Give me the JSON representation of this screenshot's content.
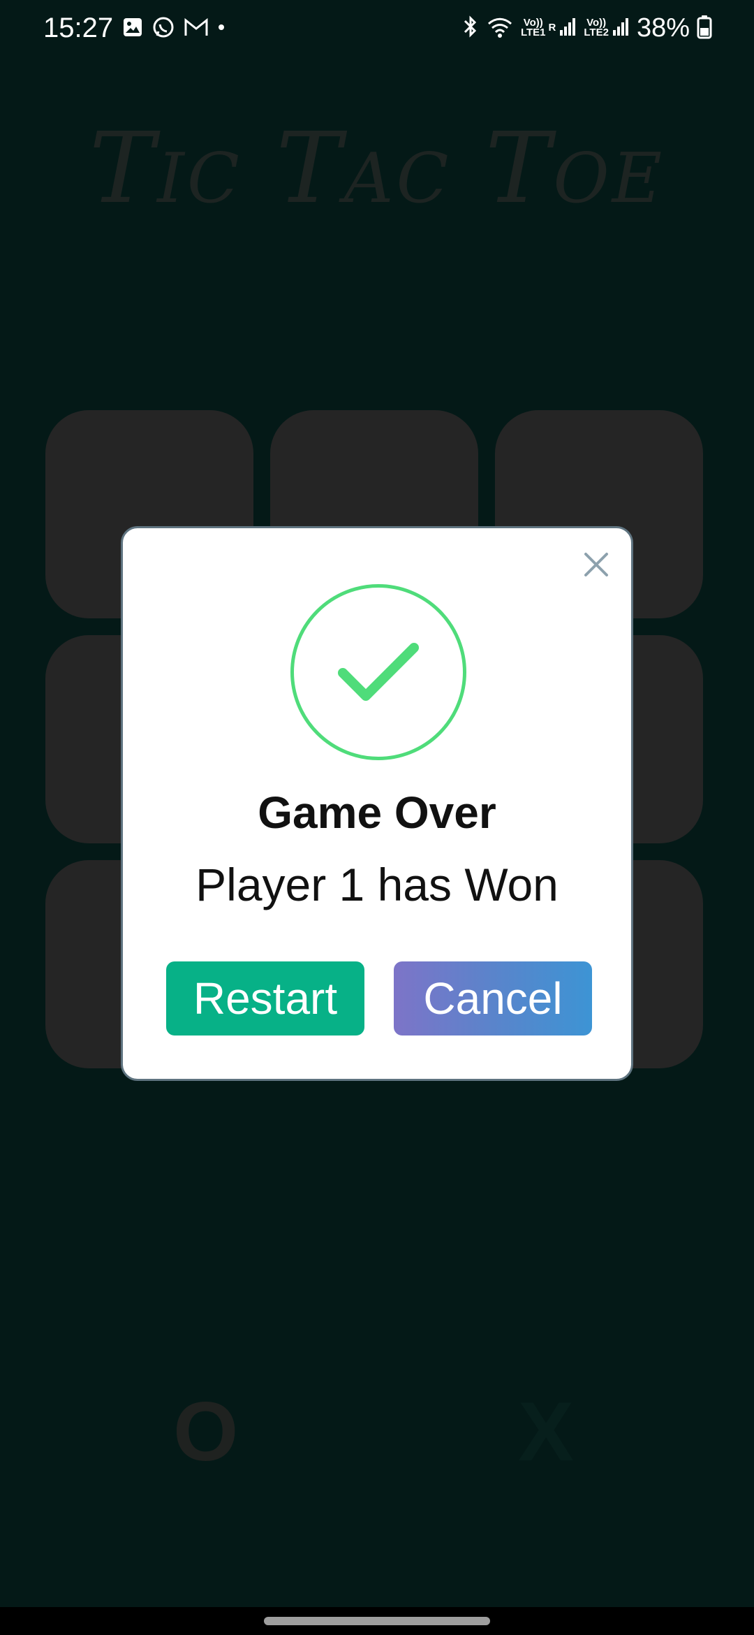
{
  "status_bar": {
    "time": "15:27",
    "battery": "38%",
    "sim1_label_top": "Vo))",
    "sim1_label_bottom": "LTE1",
    "sim2_label_top": "Vo))",
    "sim2_label_bottom": "LTE2",
    "roaming_label": "R",
    "icons": [
      "gallery-icon",
      "whatsapp-icon",
      "gmail-icon",
      "notification-dot-icon",
      "bluetooth-icon",
      "wifi-icon",
      "signal-icon",
      "battery-icon"
    ]
  },
  "game": {
    "title": "Tic Tac Toe",
    "player_o": "O",
    "player_x": "X",
    "cells": 9
  },
  "modal": {
    "title": "Game Over",
    "message": "Player 1 has Won",
    "restart_label": "Restart",
    "cancel_label": "Cancel"
  },
  "colors": {
    "background": "#041917",
    "cell": "#252525",
    "success": "#4fdc7a",
    "restart": "#07b187",
    "cancel_start": "#7d74c8",
    "cancel_end": "#3d94d4"
  }
}
